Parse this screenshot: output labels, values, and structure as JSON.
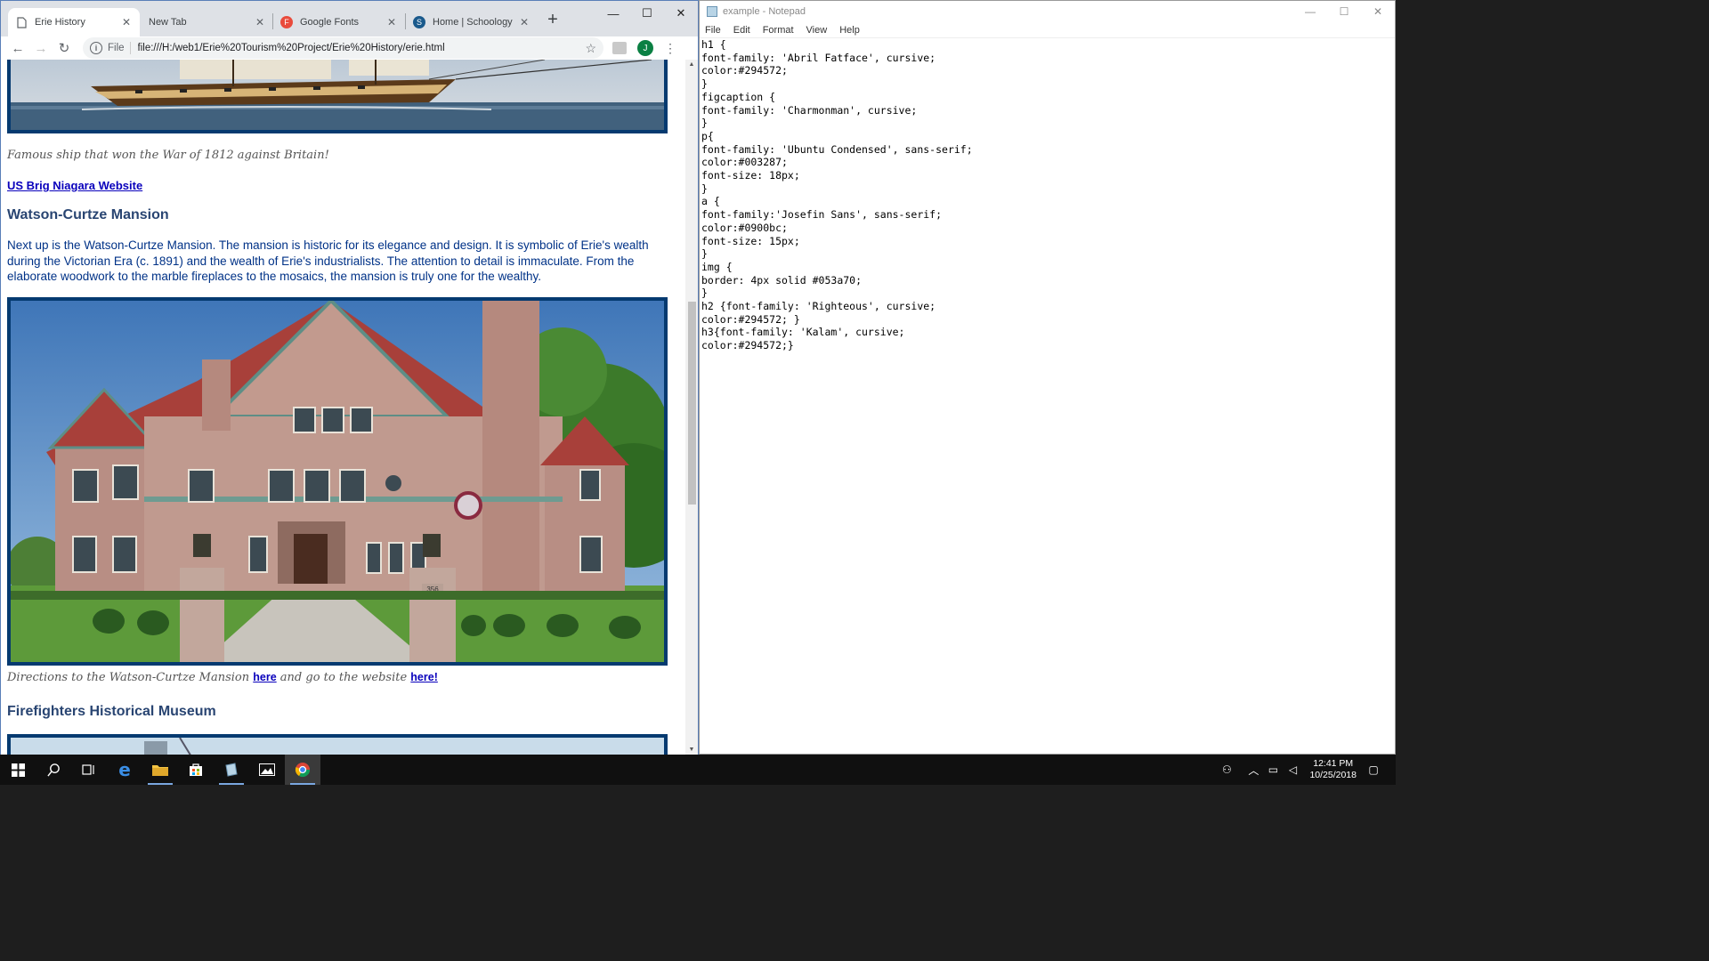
{
  "browser": {
    "tabs": [
      {
        "title": "Erie History",
        "active": true,
        "icon": "page-icon"
      },
      {
        "title": "New Tab",
        "active": false,
        "icon": "none"
      },
      {
        "title": "Google Fonts",
        "active": false,
        "icon": "google-fonts-icon"
      },
      {
        "title": "Home | Schoology",
        "active": false,
        "icon": "schoology-icon"
      }
    ],
    "new_tab_symbol": "+",
    "address": {
      "scheme_label": "File",
      "url": "file:///H:/web1/Erie%20Tourism%20Project/Erie%20History/erie.html"
    },
    "profile_initial": "J"
  },
  "page": {
    "ship_caption": "Famous ship that won the War of 1812 against Britain!",
    "niagara_link": "US Brig Niagara Website",
    "mansion_heading": "Watson-Curtze Mansion",
    "mansion_paragraph": "Next up is the Watson-Curtze Mansion. The mansion is historic for its elegance and design. It is symbolic of Erie's wealth during the Victorian Era (c. 1891) and the wealth of Erie's industrialists. The attention to detail is immaculate. From the elaborate woodwork to the marble fireplaces to the mosaics, the mansion is truly one for the wealthy.",
    "mansion_caption_prefix": "Directions to the Watson-Curtze Mansion ",
    "mansion_caption_link1": "here",
    "mansion_caption_mid": " and go to the website ",
    "mansion_caption_link2": "here!",
    "house_number": "356",
    "firefighters_heading": "Firefighters Historical Museum"
  },
  "notepad": {
    "title": "example - Notepad",
    "menu": [
      "File",
      "Edit",
      "Format",
      "View",
      "Help"
    ],
    "text": "h1 {\nfont-family: 'Abril Fatface', cursive;\ncolor:#294572;\n}\nfigcaption {\nfont-family: 'Charmonman', cursive;\n}\np{\nfont-family: 'Ubuntu Condensed', sans-serif;\ncolor:#003287;\nfont-size: 18px;\n}\na {\nfont-family:'Josefin Sans', sans-serif;\ncolor:#0900bc;\nfont-size: 15px;\n}\nimg {\nborder: 4px solid #053a70;\n}\nh2 {font-family: 'Righteous', cursive;\ncolor:#294572; }\nh3{font-family: 'Kalam', cursive;\ncolor:#294572;}"
  },
  "taskbar": {
    "time": "12:41 PM",
    "date": "10/25/2018"
  },
  "colors": {
    "heading": "#294572",
    "paragraph": "#003287",
    "link": "#0900bc",
    "img_border": "#053a70"
  }
}
